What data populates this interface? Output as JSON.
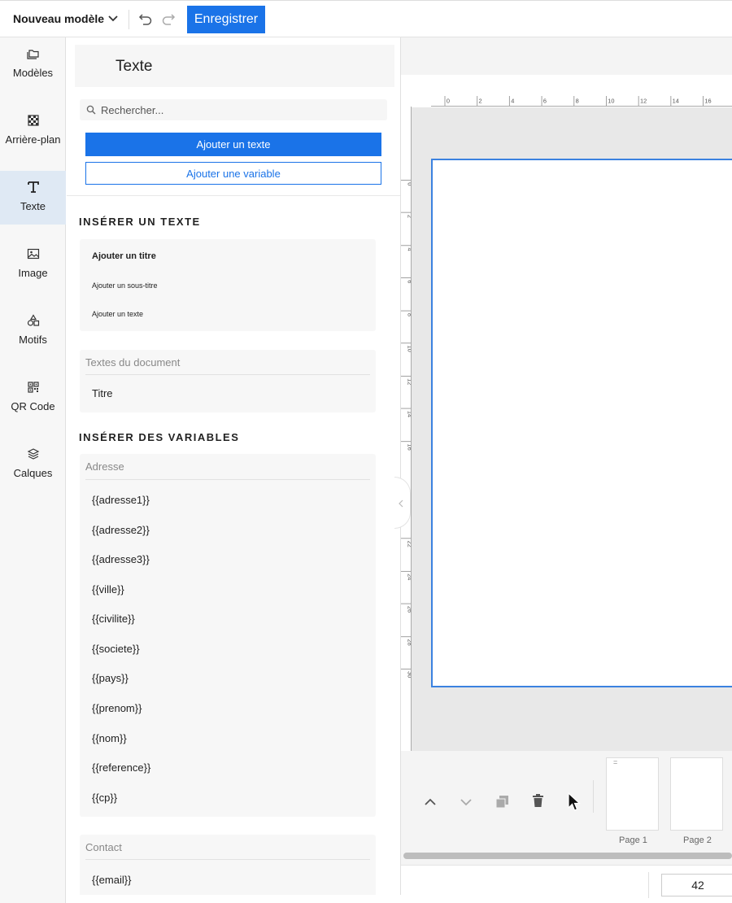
{
  "topbar": {
    "doc_title": "Nouveau modèle",
    "save_label": "Enregistrer"
  },
  "nav": {
    "items": [
      {
        "label": "Modèles",
        "icon": "folders-icon"
      },
      {
        "label": "Arrière-plan",
        "icon": "background-pattern-icon"
      },
      {
        "label": "Texte",
        "icon": "text-icon"
      },
      {
        "label": "Image",
        "icon": "image-icon"
      },
      {
        "label": "Motifs",
        "icon": "shapes-icon"
      },
      {
        "label": "QR Code",
        "icon": "qr-code-icon"
      },
      {
        "label": "Calques",
        "icon": "layers-icon"
      }
    ],
    "active": "Texte"
  },
  "panel": {
    "title": "Texte",
    "search_placeholder": "Rechercher...",
    "add_text_label": "Ajouter un texte",
    "add_variable_label": "Ajouter une variable",
    "insert_text_heading": "INSÉRER UN TEXTE",
    "text_options": {
      "title": "Ajouter un titre",
      "subtitle": "Ajouter un sous-titre",
      "body": "Ajouter un texte"
    },
    "document_texts": {
      "heading": "Textes du document",
      "items": [
        "Titre"
      ]
    },
    "insert_vars_heading": "INSÉRER DES VARIABLES",
    "address_group": {
      "heading": "Adresse",
      "items": [
        "{{adresse1}}",
        "{{adresse2}}",
        "{{adresse3}}",
        "{{ville}}",
        "{{civilite}}",
        "{{societe}}",
        "{{pays}}",
        "{{prenom}}",
        "{{nom}}",
        "{{reference}}",
        "{{cp}}"
      ]
    },
    "contact_group": {
      "heading": "Contact",
      "items": [
        "{{email}}"
      ]
    }
  },
  "workspace": {
    "ruler_top_labels": [
      "0",
      "2",
      "4",
      "6",
      "8",
      "10",
      "12",
      "14",
      "16"
    ],
    "ruler_left_labels": [
      "0",
      "2",
      "4",
      "6",
      "8",
      "10",
      "12",
      "14",
      "16",
      "22",
      "24",
      "26",
      "28",
      "30"
    ],
    "pages": [
      {
        "label": "Page 1",
        "mark": "="
      },
      {
        "label": "Page 2",
        "mark": ""
      }
    ],
    "zoom": "42"
  },
  "colors": {
    "accent": "#1a73e8",
    "active_nav": "#dfe9f4",
    "page_border": "#3b82e0"
  }
}
